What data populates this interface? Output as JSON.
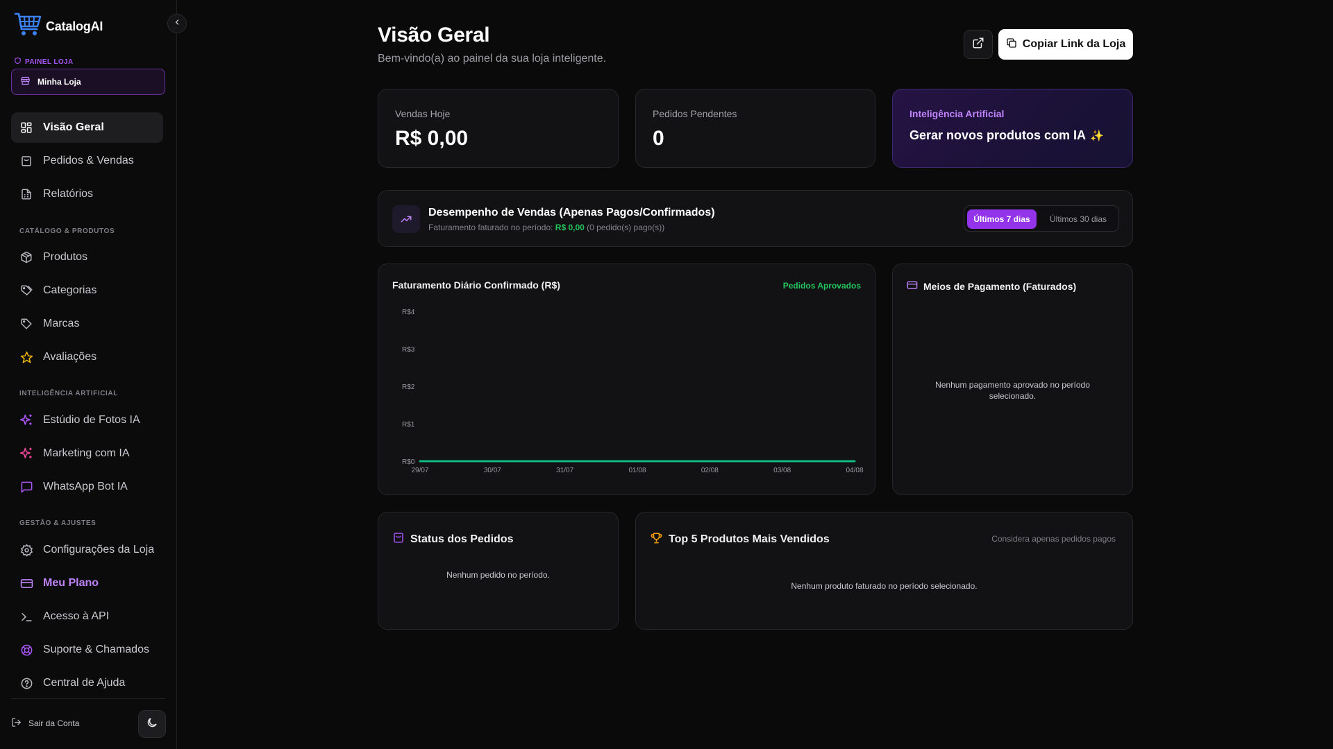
{
  "brand": {
    "name": "CatalogAI"
  },
  "sidebar": {
    "panel_label": "PAINEL LOJA",
    "store_name": "Minha Loja",
    "items_top": [
      {
        "label": "Visão Geral",
        "icon": "layout-grid-icon",
        "active": true
      },
      {
        "label": "Pedidos & Vendas",
        "icon": "shopping-bag-icon"
      },
      {
        "label": "Relatórios",
        "icon": "report-icon"
      }
    ],
    "section_catalog": "CATÁLOGO & PRODUTOS",
    "items_catalog": [
      {
        "label": "Produtos",
        "icon": "box-icon"
      },
      {
        "label": "Categorias",
        "icon": "tags-icon"
      },
      {
        "label": "Marcas",
        "icon": "tag-icon"
      },
      {
        "label": "Avaliações",
        "icon": "star-icon"
      }
    ],
    "section_ai": "INTELIGÊNCIA ARTIFICIAL",
    "items_ai": [
      {
        "label": "Estúdio de Fotos IA",
        "icon": "sparkles-icon"
      },
      {
        "label": "Marketing com IA",
        "icon": "sparkles-pink-icon"
      },
      {
        "label": "WhatsApp Bot IA",
        "icon": "message-square-icon"
      }
    ],
    "section_manage": "GESTÃO & AJUSTES",
    "items_manage": [
      {
        "label": "Configurações da Loja",
        "icon": "gear-icon"
      },
      {
        "label": "Meu Plano",
        "icon": "credit-card-icon"
      },
      {
        "label": "Acesso à API",
        "icon": "terminal-icon"
      },
      {
        "label": "Suporte & Chamados",
        "icon": "life-buoy-icon"
      },
      {
        "label": "Central de Ajuda",
        "icon": "help-circle-icon"
      }
    ],
    "logout_label": "Sair da Conta"
  },
  "header": {
    "title": "Visão Geral",
    "subtitle": "Bem-vindo(a) ao painel da sua loja inteligente.",
    "copy_link_label": "Copiar Link da Loja"
  },
  "stats": {
    "sales_today_label": "Vendas Hoje",
    "sales_today_value": "R$ 0,00",
    "pending_orders_label": "Pedidos Pendentes",
    "pending_orders_value": "0",
    "ai_label": "Inteligência Artificial",
    "ai_text": "Gerar novos produtos com IA",
    "ai_emoji": "✨"
  },
  "performance": {
    "title": "Desempenho de Vendas (Apenas Pagos/Confirmados)",
    "sub_prefix": "Faturamento faturado no período: ",
    "sub_amount": "R$ 0,00",
    "sub_suffix": " (0 pedido(s) pago(s))",
    "range_7": "Últimos 7 dias",
    "range_30": "Últimos 30 dias"
  },
  "chart_data": {
    "type": "line",
    "title": "Faturamento Diário Confirmado (R$)",
    "badge": "Pedidos Aprovados",
    "categories": [
      "29/07",
      "30/07",
      "31/07",
      "01/08",
      "02/08",
      "03/08",
      "04/08"
    ],
    "series": [
      {
        "values": [
          0,
          0,
          0,
          0,
          0,
          0,
          0
        ]
      }
    ],
    "ylim": [
      0,
      4
    ],
    "y_ticks": [
      "R$0",
      "R$1",
      "R$2",
      "R$3",
      "R$4"
    ],
    "line_color": "#10b981"
  },
  "payments": {
    "title": "Meios de Pagamento (Faturados)",
    "empty": "Nenhum pagamento aprovado no período selecionado."
  },
  "orders_status": {
    "title": "Status dos Pedidos",
    "empty": "Nenhum pedido no período."
  },
  "top_products": {
    "title": "Top 5 Produtos Mais Vendidos",
    "note": "Considera apenas pedidos pagos",
    "empty": "Nenhum produto faturado no período selecionado."
  },
  "colors": {
    "accent": "#9333ea",
    "accent_light": "#c084fc",
    "success": "#22c55e",
    "trophy": "#f59e0b"
  }
}
